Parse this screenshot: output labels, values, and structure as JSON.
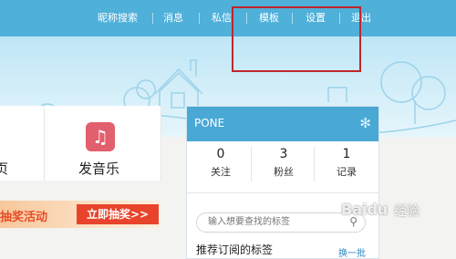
{
  "nav": {
    "items": [
      "昵称搜索",
      "消息",
      "私信",
      "模板",
      "设置",
      "退出"
    ]
  },
  "left_card": {
    "clipped_label": "页",
    "music_label": "发音乐"
  },
  "banner": {
    "text": "抽奖活动",
    "button": "立即抽奖>>"
  },
  "panel": {
    "username": "PONE",
    "stats": [
      {
        "num": "0",
        "label": "关注"
      },
      {
        "num": "3",
        "label": "粉丝"
      },
      {
        "num": "1",
        "label": "记录"
      }
    ],
    "search_placeholder": "输入想要查找的标签",
    "recommend_title": "推荐订阅的标签",
    "switch_label": "换一批"
  },
  "watermark": {
    "brand": "Baidu",
    "suffix": "经验"
  },
  "colors": {
    "nav_bg": "#4fb0d9",
    "panel_header": "#49a8d4",
    "highlight": "#c0262d",
    "banner_button": "#e8442b"
  }
}
